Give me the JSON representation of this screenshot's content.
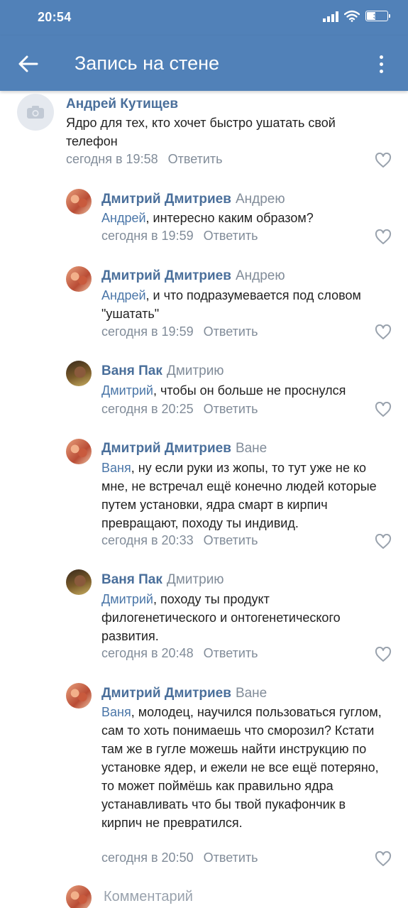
{
  "status_bar": {
    "time": "20:54",
    "battery_level": "39"
  },
  "header": {
    "title": "Запись на стене"
  },
  "comments": [
    {
      "author": "Андрей Кутищев",
      "reply_to": "",
      "mention": "",
      "text": "Ядро для тех, кто хочет быстро ушатать свой телефон",
      "time": "сегодня в 19:58",
      "reply_label": "Ответить"
    },
    {
      "author": "Дмитрий Дмитриев",
      "reply_to": "Андрею",
      "mention": "Андрей",
      "text": ", интересно каким образом?",
      "time": "сегодня в 19:59",
      "reply_label": "Ответить"
    },
    {
      "author": "Дмитрий Дмитриев",
      "reply_to": "Андрею",
      "mention": "Андрей",
      "text": ", и что подразумевается под словом \"ушатать\"",
      "time": "сегодня в 19:59",
      "reply_label": "Ответить"
    },
    {
      "author": "Ваня Пак",
      "reply_to": "Дмитрию",
      "mention": "Дмитрий",
      "text": ", чтобы он больше не проснулся",
      "time": "сегодня в 20:25",
      "reply_label": "Ответить"
    },
    {
      "author": "Дмитрий Дмитриев",
      "reply_to": "Ване",
      "mention": "Ваня",
      "text": ", ну если руки из жопы, то тут уже не ко мне, не встречал ещё конечно людей которые путем установки, ядра смарт в кирпич превращают, походу ты индивид.",
      "time": "сегодня в 20:33",
      "reply_label": "Ответить"
    },
    {
      "author": "Ваня Пак",
      "reply_to": "Дмитрию",
      "mention": "Дмитрий",
      "text": ", походу ты продукт филогенетического и онтогенетического развития.",
      "time": "сегодня в 20:48",
      "reply_label": "Ответить"
    },
    {
      "author": "Дмитрий Дмитриев",
      "reply_to": "Ване",
      "mention": "Ваня",
      "text": ", молодец, научился пользоваться гуглом, сам то хоть понимаешь что сморозил? Кстати там же в гугле можешь найти инструкцию по установке ядер, и ежели не все ещё потеряно, то может поймёшь как правильно ядра устанавливать что бы твой пукафончик в кирпич не превратился.",
      "time": "сегодня в 20:50",
      "reply_label": "Ответить"
    }
  ],
  "composer": {
    "placeholder": "Комментарий"
  },
  "colors": {
    "header_bg": "#5181b8",
    "author": "#4a6f9b",
    "mention": "#4a76a8",
    "meta": "#818c99"
  }
}
